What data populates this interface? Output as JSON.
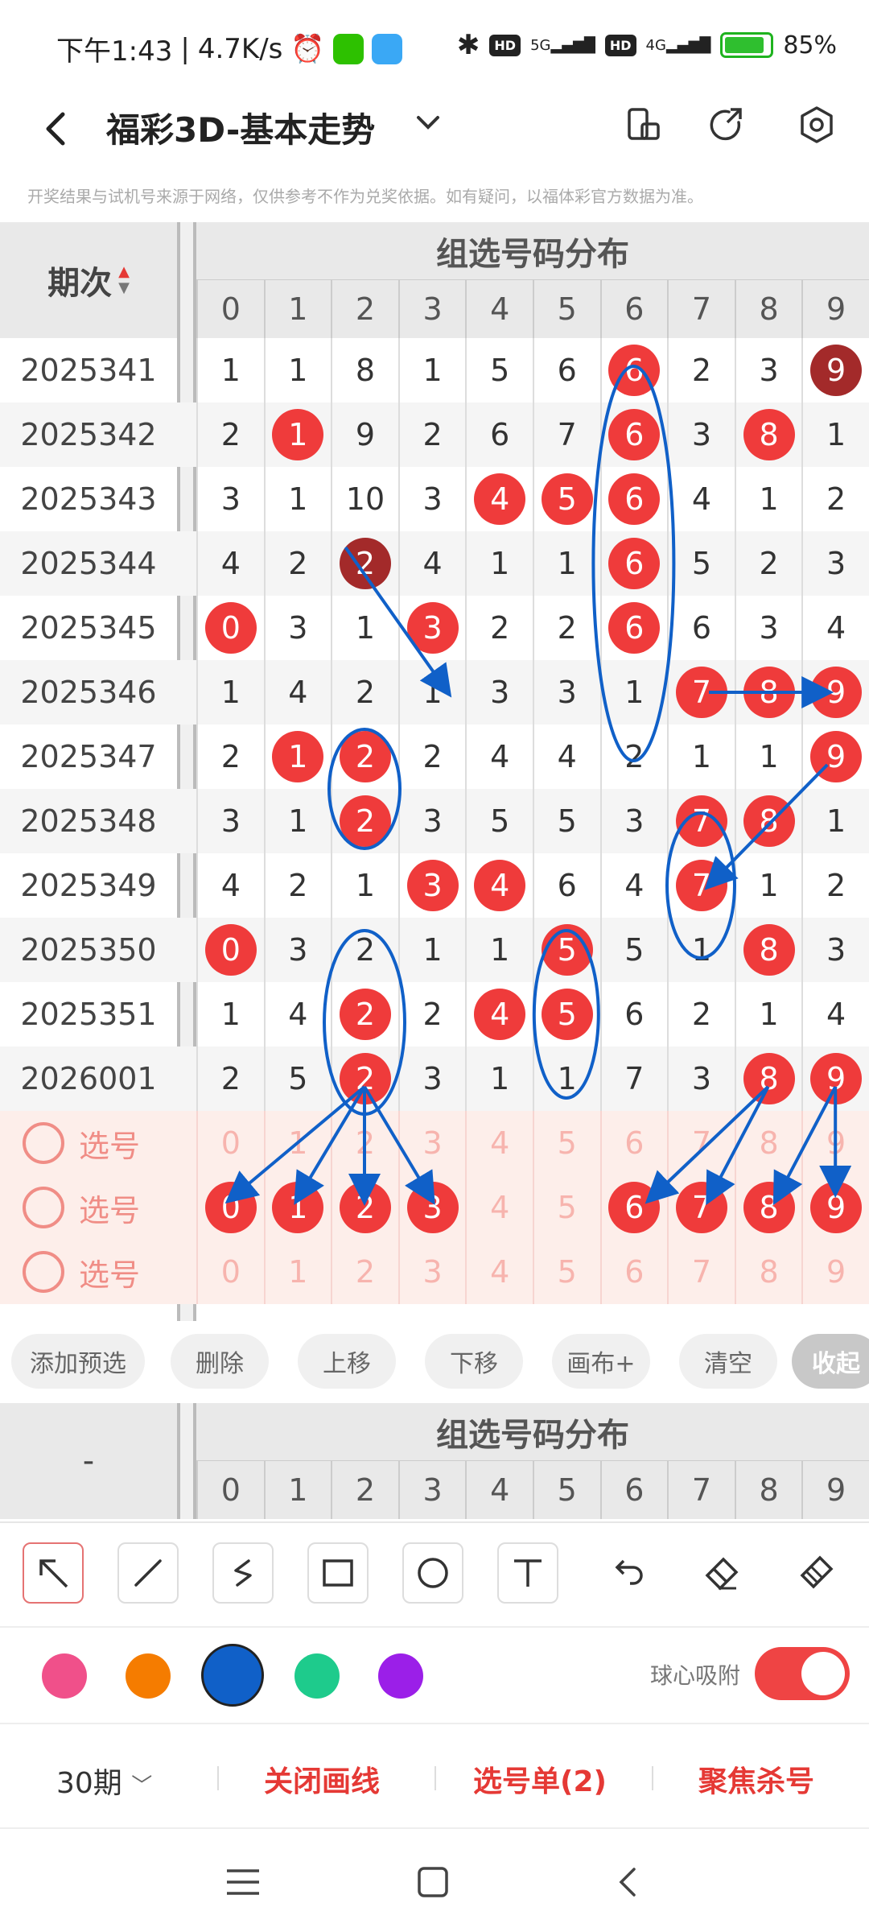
{
  "status": {
    "time": "下午1:43",
    "speed": "4.7K/s",
    "battery": "85%",
    "hd1": "HD",
    "hd2": "HD",
    "net1": "5G",
    "net2": "4G"
  },
  "header": {
    "title": "福彩3D-基本走势"
  },
  "disclaimer": "开奖结果与试机号来源于网络，仅供参考不作为兑奖依据。如有疑问，以福体彩官方数据为准。",
  "table": {
    "issue_header": "期次",
    "group_title": "组选号码分布",
    "digits": [
      "0",
      "1",
      "2",
      "3",
      "4",
      "5",
      "6",
      "7",
      "8",
      "9"
    ],
    "rows": [
      {
        "issue": "2025341",
        "cells": [
          "1",
          "1",
          "8",
          "1",
          "5",
          "6",
          "6",
          "2",
          "3",
          "9"
        ],
        "balls": [
          6,
          9
        ],
        "dark": [
          9
        ]
      },
      {
        "issue": "2025342",
        "cells": [
          "2",
          "1",
          "9",
          "2",
          "6",
          "7",
          "6",
          "3",
          "8",
          "1"
        ],
        "balls": [
          1,
          6,
          8
        ],
        "dark": []
      },
      {
        "issue": "2025343",
        "cells": [
          "3",
          "1",
          "10",
          "3",
          "4",
          "5",
          "6",
          "4",
          "1",
          "2"
        ],
        "balls": [
          4,
          5,
          6
        ],
        "dark": []
      },
      {
        "issue": "2025344",
        "cells": [
          "4",
          "2",
          "2",
          "4",
          "1",
          "1",
          "6",
          "5",
          "2",
          "3"
        ],
        "balls": [
          2,
          6
        ],
        "dark": [
          2
        ]
      },
      {
        "issue": "2025345",
        "cells": [
          "0",
          "3",
          "1",
          "3",
          "2",
          "2",
          "6",
          "6",
          "3",
          "4"
        ],
        "balls": [
          0,
          3,
          6
        ],
        "dark": []
      },
      {
        "issue": "2025346",
        "cells": [
          "1",
          "4",
          "2",
          "1",
          "3",
          "3",
          "1",
          "7",
          "8",
          "9"
        ],
        "balls": [
          7,
          8,
          9
        ],
        "dark": []
      },
      {
        "issue": "2025347",
        "cells": [
          "2",
          "1",
          "2",
          "2",
          "4",
          "4",
          "2",
          "1",
          "1",
          "9"
        ],
        "balls": [
          1,
          2,
          9
        ],
        "dark": []
      },
      {
        "issue": "2025348",
        "cells": [
          "3",
          "1",
          "2",
          "3",
          "5",
          "5",
          "3",
          "7",
          "8",
          "1"
        ],
        "balls": [
          2,
          7,
          8
        ],
        "dark": []
      },
      {
        "issue": "2025349",
        "cells": [
          "4",
          "2",
          "1",
          "3",
          "4",
          "6",
          "4",
          "7",
          "1",
          "2"
        ],
        "balls": [
          3,
          4,
          7
        ],
        "dark": []
      },
      {
        "issue": "2025350",
        "cells": [
          "0",
          "3",
          "2",
          "1",
          "1",
          "5",
          "5",
          "1",
          "8",
          "3"
        ],
        "balls": [
          0,
          5,
          8
        ],
        "dark": []
      },
      {
        "issue": "2025351",
        "cells": [
          "1",
          "4",
          "2",
          "2",
          "4",
          "5",
          "6",
          "2",
          "1",
          "4"
        ],
        "balls": [
          2,
          4,
          5
        ],
        "dark": []
      },
      {
        "issue": "2026001",
        "cells": [
          "2",
          "5",
          "2",
          "3",
          "1",
          "1",
          "7",
          "3",
          "8",
          "9"
        ],
        "balls": [
          2,
          8,
          9
        ],
        "dark": []
      }
    ],
    "pick_rows": [
      {
        "label": "选号",
        "cells": [
          "0",
          "1",
          "2",
          "3",
          "4",
          "5",
          "6",
          "7",
          "8",
          "9"
        ],
        "balls": []
      },
      {
        "label": "选号",
        "cells": [
          "0",
          "1",
          "2",
          "3",
          "4",
          "5",
          "6",
          "7",
          "8",
          "9"
        ],
        "balls": [
          0,
          1,
          2,
          3,
          6,
          7,
          8,
          9
        ]
      },
      {
        "label": "选号",
        "cells": [
          "0",
          "1",
          "2",
          "3",
          "4",
          "5",
          "6",
          "7",
          "8",
          "9"
        ],
        "balls": []
      }
    ]
  },
  "actions": {
    "add": "添加预选",
    "delete": "删除",
    "up": "上移",
    "down": "下移",
    "canvas": "画布+",
    "clear": "清空",
    "collapse": "收起"
  },
  "table2": {
    "issue_header": "-",
    "group_title": "组选号码分布",
    "digits": [
      "0",
      "1",
      "2",
      "3",
      "4",
      "5",
      "6",
      "7",
      "8",
      "9"
    ]
  },
  "tools": [
    "arrow-tool",
    "line-tool",
    "curve-tool",
    "rect-tool",
    "circle-tool",
    "text-tool",
    "undo-tool",
    "eraser-tool",
    "clear-brush-tool"
  ],
  "colors": [
    "#f0508a",
    "#f57c00",
    "#1060c8",
    "#1ecb8c",
    "#9b1fe8"
  ],
  "snap": {
    "label": "球心吸附",
    "on": true
  },
  "bottom": {
    "period": "30期",
    "close_lines": "关闭画线",
    "pick_list": "选号单(2)",
    "focus_kill": "聚焦杀号"
  },
  "accent": "#e53935"
}
